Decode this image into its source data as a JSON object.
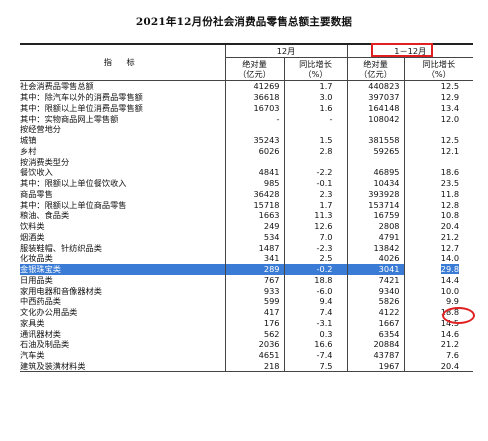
{
  "title": "2021年12月份社会消费品零售总额主要数据",
  "header": {
    "indicator": "指 标",
    "group1": "12月",
    "group2": "1－12月",
    "abs_label_1": "绝对量",
    "abs_unit_1": "（亿元）",
    "yoy_label_1": "同比增长",
    "yoy_unit_1": "（%）",
    "abs_label_2": "绝对量",
    "abs_unit_2": "（亿元）",
    "yoy_label_2": "同比增长",
    "yoy_unit_2": "（%）"
  },
  "rows": [
    {
      "name": "社会消费品零售总额",
      "m_abs": "41269",
      "m_yoy": "1.7",
      "y_abs": "440823",
      "y_yoy": "12.5"
    },
    {
      "name": "其中：除汽车以外的消费品零售额",
      "m_abs": "36618",
      "m_yoy": "3.0",
      "y_abs": "397037",
      "y_yoy": "12.9"
    },
    {
      "name": "其中：限额以上单位消费品零售额",
      "m_abs": "16703",
      "m_yoy": "1.6",
      "y_abs": "164148",
      "y_yoy": "13.4"
    },
    {
      "name": "其中：实物商品网上零售额",
      "m_abs": "-",
      "m_yoy": "-",
      "y_abs": "108042",
      "y_yoy": "12.0"
    },
    {
      "name": "按经营地分",
      "m_abs": "",
      "m_yoy": "",
      "y_abs": "",
      "y_yoy": ""
    },
    {
      "name": "城镇",
      "m_abs": "35243",
      "m_yoy": "1.5",
      "y_abs": "381558",
      "y_yoy": "12.5"
    },
    {
      "name": "乡村",
      "m_abs": "6026",
      "m_yoy": "2.8",
      "y_abs": "59265",
      "y_yoy": "12.1"
    },
    {
      "name": "按消费类型分",
      "m_abs": "",
      "m_yoy": "",
      "y_abs": "",
      "y_yoy": ""
    },
    {
      "name": "餐饮收入",
      "m_abs": "4841",
      "m_yoy": "-2.2",
      "y_abs": "46895",
      "y_yoy": "18.6"
    },
    {
      "name": "其中：限额以上单位餐饮收入",
      "m_abs": "985",
      "m_yoy": "-0.1",
      "y_abs": "10434",
      "y_yoy": "23.5"
    },
    {
      "name": "商品零售",
      "m_abs": "36428",
      "m_yoy": "2.3",
      "y_abs": "393928",
      "y_yoy": "11.8"
    },
    {
      "name": "其中：限额以上单位商品零售",
      "m_abs": "15718",
      "m_yoy": "1.7",
      "y_abs": "153714",
      "y_yoy": "12.8"
    },
    {
      "name": "粮油、食品类",
      "m_abs": "1663",
      "m_yoy": "11.3",
      "y_abs": "16759",
      "y_yoy": "10.8"
    },
    {
      "name": "饮料类",
      "m_abs": "249",
      "m_yoy": "12.6",
      "y_abs": "2808",
      "y_yoy": "20.4"
    },
    {
      "name": "烟酒类",
      "m_abs": "534",
      "m_yoy": "7.0",
      "y_abs": "4791",
      "y_yoy": "21.2"
    },
    {
      "name": "服装鞋帽、针纺织品类",
      "m_abs": "1487",
      "m_yoy": "-2.3",
      "y_abs": "13842",
      "y_yoy": "12.7"
    },
    {
      "name": "化妆品类",
      "m_abs": "341",
      "m_yoy": "2.5",
      "y_abs": "4026",
      "y_yoy": "14.0"
    },
    {
      "name": "金银珠宝类",
      "m_abs": "289",
      "m_yoy": "-0.2",
      "y_abs": "3041",
      "y_yoy": "29.8"
    },
    {
      "name": "日用品类",
      "m_abs": "767",
      "m_yoy": "18.8",
      "y_abs": "7421",
      "y_yoy": "14.4"
    },
    {
      "name": "家用电器和音像器材类",
      "m_abs": "933",
      "m_yoy": "-6.0",
      "y_abs": "9340",
      "y_yoy": "10.0"
    },
    {
      "name": "中西药品类",
      "m_abs": "599",
      "m_yoy": "9.4",
      "y_abs": "5826",
      "y_yoy": "9.9"
    },
    {
      "name": "文化办公用品类",
      "m_abs": "417",
      "m_yoy": "7.4",
      "y_abs": "4122",
      "y_yoy": "18.8"
    },
    {
      "name": "家具类",
      "m_abs": "176",
      "m_yoy": "-3.1",
      "y_abs": "1667",
      "y_yoy": "14.5"
    },
    {
      "name": "通讯器材类",
      "m_abs": "562",
      "m_yoy": "0.3",
      "y_abs": "6354",
      "y_yoy": "14.6"
    },
    {
      "name": "石油及制品类",
      "m_abs": "2036",
      "m_yoy": "16.6",
      "y_abs": "20884",
      "y_yoy": "21.2"
    },
    {
      "name": "汽车类",
      "m_abs": "4651",
      "m_yoy": "-7.4",
      "y_abs": "43787",
      "y_yoy": "7.6"
    },
    {
      "name": "建筑及装潢材料类",
      "m_abs": "218",
      "m_yoy": "7.5",
      "y_abs": "1967",
      "y_yoy": "20.4"
    }
  ],
  "colors": {
    "highlight": "#3a7bd5",
    "annotation": "#e02020"
  }
}
